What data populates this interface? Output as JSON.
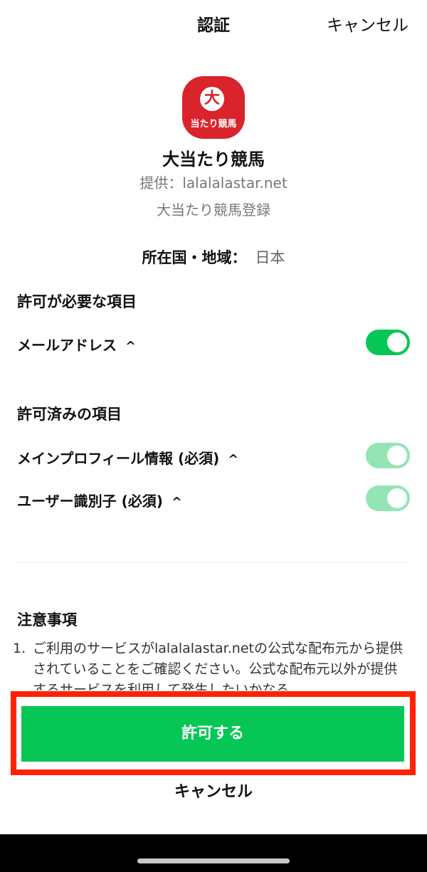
{
  "header": {
    "title": "認証",
    "cancel_label": "キャンセル"
  },
  "app": {
    "logo_glyph": "大",
    "logo_text": "当たり競馬",
    "name": "大当たり競馬",
    "provider": "提供：lalalalastar.net",
    "description": "大当たり競馬登録"
  },
  "region": {
    "label": "所在国・地域：",
    "value": "日本"
  },
  "required_section": {
    "title": "許可が必要な項目",
    "items": [
      {
        "label": "メールアドレス",
        "enabled": true
      }
    ]
  },
  "granted_section": {
    "title": "許可済みの項目",
    "items": [
      {
        "label": "メインプロフィール情報 (必須)",
        "enabled": true
      },
      {
        "label": "ユーザー識別子 (必須)",
        "enabled": true
      }
    ]
  },
  "notes": {
    "title": "注意事項",
    "items": [
      {
        "number": "1.",
        "text": "ご利用のサービスがlalalalastar.netの公式な配布元から提供されていることをご確認ください。公式な配布元以外が提供するサービスを利用して発生したいかなる"
      }
    ]
  },
  "footer": {
    "allow_label": "許可する",
    "cancel_label": "キャンセル"
  },
  "colors": {
    "accent_green": "#06c755",
    "disabled_green": "#94e5b4",
    "highlight_red": "#ff2200",
    "logo_red": "#d8242a"
  },
  "icons": {
    "expand": "chevron-up-icon",
    "home": "home-indicator"
  }
}
